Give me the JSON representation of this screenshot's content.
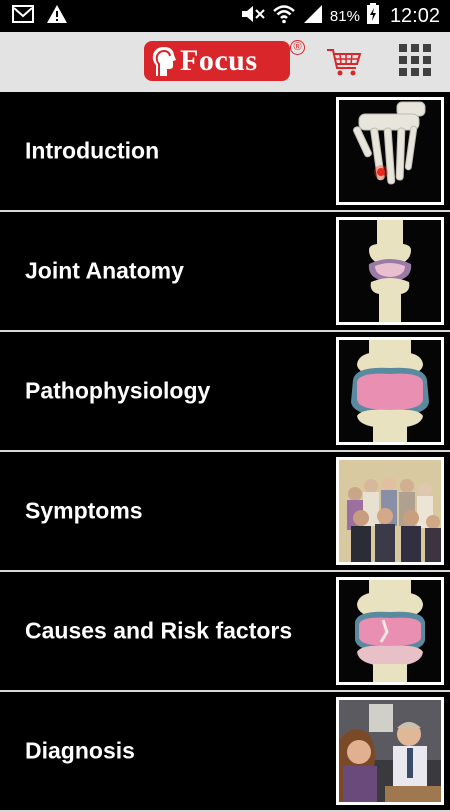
{
  "status_bar": {
    "battery_percent": "81%",
    "time": "12:02",
    "icons": [
      "mail-icon",
      "warning-icon",
      "mute-icon",
      "wifi-icon",
      "signal-icon",
      "battery-charging-icon"
    ]
  },
  "header": {
    "logo_text": "Focus",
    "logo_registered": "®",
    "icons": [
      "cart-icon",
      "grid-menu-icon"
    ],
    "colors": {
      "brand_red": "#d9262a",
      "header_bg": "#e3e3e3"
    }
  },
  "menu": {
    "items": [
      {
        "label": "Introduction",
        "thumb": "hand-bones-thumbnail"
      },
      {
        "label": "Joint Anatomy",
        "thumb": "knee-joint-thumbnail"
      },
      {
        "label": "Pathophysiology",
        "thumb": "inflamed-joint-thumbnail"
      },
      {
        "label": "Symptoms",
        "thumb": "group-of-people-thumbnail"
      },
      {
        "label": "Causes and Risk factors",
        "thumb": "damaged-joint-thumbnail"
      },
      {
        "label": "Diagnosis",
        "thumb": "doctor-consultation-thumbnail"
      }
    ]
  }
}
